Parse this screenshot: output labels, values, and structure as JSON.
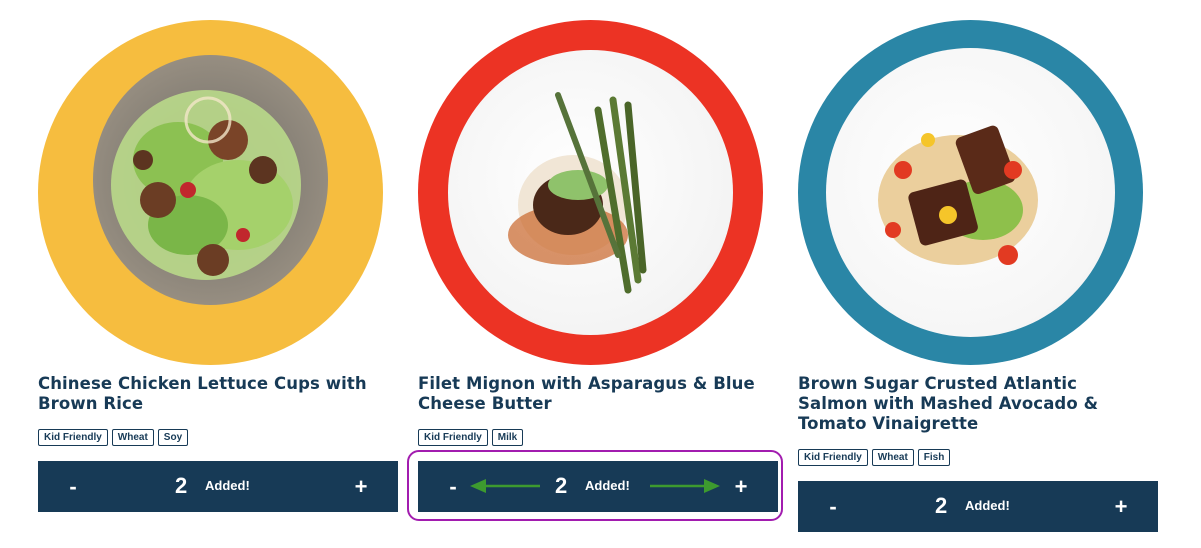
{
  "cards": [
    {
      "title": "Chinese Chicken Lettuce Cups with Brown Rice",
      "tags": [
        "Kid Friendly",
        "Wheat",
        "Soy"
      ],
      "quantity": "2",
      "status": "Added!",
      "minus_label": "-",
      "plus_label": "+",
      "ring_color": "#f6bd3f",
      "image": "chinese-chicken-lettuce-cups-photo"
    },
    {
      "title": "Filet Mignon with Asparagus & Blue Cheese Butter",
      "tags": [
        "Kid Friendly",
        "Milk"
      ],
      "quantity": "2",
      "status": "Added!",
      "minus_label": "-",
      "plus_label": "+",
      "ring_color": "#ec3324",
      "image": "filet-mignon-asparagus-photo"
    },
    {
      "title": "Brown Sugar Crusted Atlantic Salmon with Mashed Avocado & Tomato Vinaigrette",
      "tags": [
        "Kid Friendly",
        "Wheat",
        "Fish"
      ],
      "quantity": "2",
      "status": "Added!",
      "minus_label": "-",
      "plus_label": "+",
      "ring_color": "#2a86a6",
      "image": "salmon-avocado-photo"
    }
  ],
  "colors": {
    "navy": "#173a56",
    "highlight": "#a21caf",
    "arrow": "#3d9a2f"
  }
}
